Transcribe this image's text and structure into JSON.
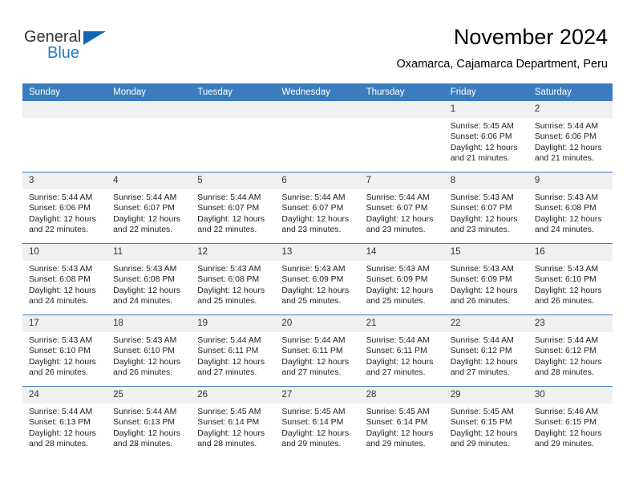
{
  "brand": {
    "name_part1": "General",
    "name_part2": "Blue"
  },
  "header": {
    "title": "November 2024",
    "subtitle": "Oxamarca, Cajamarca Department, Peru"
  },
  "calendar": {
    "weekday_headers": [
      "Sunday",
      "Monday",
      "Tuesday",
      "Wednesday",
      "Thursday",
      "Friday",
      "Saturday"
    ],
    "accent_color": "#3a7cbd",
    "daynum_band_color": "#f0f0f0",
    "weeks": [
      [
        {
          "day": "",
          "empty": true
        },
        {
          "day": "",
          "empty": true
        },
        {
          "day": "",
          "empty": true
        },
        {
          "day": "",
          "empty": true
        },
        {
          "day": "",
          "empty": true
        },
        {
          "day": "1",
          "sunrise": "Sunrise: 5:45 AM",
          "sunset": "Sunset: 6:06 PM",
          "daylight_l1": "Daylight: 12 hours",
          "daylight_l2": "and 21 minutes."
        },
        {
          "day": "2",
          "sunrise": "Sunrise: 5:44 AM",
          "sunset": "Sunset: 6:06 PM",
          "daylight_l1": "Daylight: 12 hours",
          "daylight_l2": "and 21 minutes."
        }
      ],
      [
        {
          "day": "3",
          "sunrise": "Sunrise: 5:44 AM",
          "sunset": "Sunset: 6:06 PM",
          "daylight_l1": "Daylight: 12 hours",
          "daylight_l2": "and 22 minutes."
        },
        {
          "day": "4",
          "sunrise": "Sunrise: 5:44 AM",
          "sunset": "Sunset: 6:07 PM",
          "daylight_l1": "Daylight: 12 hours",
          "daylight_l2": "and 22 minutes."
        },
        {
          "day": "5",
          "sunrise": "Sunrise: 5:44 AM",
          "sunset": "Sunset: 6:07 PM",
          "daylight_l1": "Daylight: 12 hours",
          "daylight_l2": "and 22 minutes."
        },
        {
          "day": "6",
          "sunrise": "Sunrise: 5:44 AM",
          "sunset": "Sunset: 6:07 PM",
          "daylight_l1": "Daylight: 12 hours",
          "daylight_l2": "and 23 minutes."
        },
        {
          "day": "7",
          "sunrise": "Sunrise: 5:44 AM",
          "sunset": "Sunset: 6:07 PM",
          "daylight_l1": "Daylight: 12 hours",
          "daylight_l2": "and 23 minutes."
        },
        {
          "day": "8",
          "sunrise": "Sunrise: 5:43 AM",
          "sunset": "Sunset: 6:07 PM",
          "daylight_l1": "Daylight: 12 hours",
          "daylight_l2": "and 23 minutes."
        },
        {
          "day": "9",
          "sunrise": "Sunrise: 5:43 AM",
          "sunset": "Sunset: 6:08 PM",
          "daylight_l1": "Daylight: 12 hours",
          "daylight_l2": "and 24 minutes."
        }
      ],
      [
        {
          "day": "10",
          "sunrise": "Sunrise: 5:43 AM",
          "sunset": "Sunset: 6:08 PM",
          "daylight_l1": "Daylight: 12 hours",
          "daylight_l2": "and 24 minutes."
        },
        {
          "day": "11",
          "sunrise": "Sunrise: 5:43 AM",
          "sunset": "Sunset: 6:08 PM",
          "daylight_l1": "Daylight: 12 hours",
          "daylight_l2": "and 24 minutes."
        },
        {
          "day": "12",
          "sunrise": "Sunrise: 5:43 AM",
          "sunset": "Sunset: 6:08 PM",
          "daylight_l1": "Daylight: 12 hours",
          "daylight_l2": "and 25 minutes."
        },
        {
          "day": "13",
          "sunrise": "Sunrise: 5:43 AM",
          "sunset": "Sunset: 6:09 PM",
          "daylight_l1": "Daylight: 12 hours",
          "daylight_l2": "and 25 minutes."
        },
        {
          "day": "14",
          "sunrise": "Sunrise: 5:43 AM",
          "sunset": "Sunset: 6:09 PM",
          "daylight_l1": "Daylight: 12 hours",
          "daylight_l2": "and 25 minutes."
        },
        {
          "day": "15",
          "sunrise": "Sunrise: 5:43 AM",
          "sunset": "Sunset: 6:09 PM",
          "daylight_l1": "Daylight: 12 hours",
          "daylight_l2": "and 26 minutes."
        },
        {
          "day": "16",
          "sunrise": "Sunrise: 5:43 AM",
          "sunset": "Sunset: 6:10 PM",
          "daylight_l1": "Daylight: 12 hours",
          "daylight_l2": "and 26 minutes."
        }
      ],
      [
        {
          "day": "17",
          "sunrise": "Sunrise: 5:43 AM",
          "sunset": "Sunset: 6:10 PM",
          "daylight_l1": "Daylight: 12 hours",
          "daylight_l2": "and 26 minutes."
        },
        {
          "day": "18",
          "sunrise": "Sunrise: 5:43 AM",
          "sunset": "Sunset: 6:10 PM",
          "daylight_l1": "Daylight: 12 hours",
          "daylight_l2": "and 26 minutes."
        },
        {
          "day": "19",
          "sunrise": "Sunrise: 5:44 AM",
          "sunset": "Sunset: 6:11 PM",
          "daylight_l1": "Daylight: 12 hours",
          "daylight_l2": "and 27 minutes."
        },
        {
          "day": "20",
          "sunrise": "Sunrise: 5:44 AM",
          "sunset": "Sunset: 6:11 PM",
          "daylight_l1": "Daylight: 12 hours",
          "daylight_l2": "and 27 minutes."
        },
        {
          "day": "21",
          "sunrise": "Sunrise: 5:44 AM",
          "sunset": "Sunset: 6:11 PM",
          "daylight_l1": "Daylight: 12 hours",
          "daylight_l2": "and 27 minutes."
        },
        {
          "day": "22",
          "sunrise": "Sunrise: 5:44 AM",
          "sunset": "Sunset: 6:12 PM",
          "daylight_l1": "Daylight: 12 hours",
          "daylight_l2": "and 27 minutes."
        },
        {
          "day": "23",
          "sunrise": "Sunrise: 5:44 AM",
          "sunset": "Sunset: 6:12 PM",
          "daylight_l1": "Daylight: 12 hours",
          "daylight_l2": "and 28 minutes."
        }
      ],
      [
        {
          "day": "24",
          "sunrise": "Sunrise: 5:44 AM",
          "sunset": "Sunset: 6:13 PM",
          "daylight_l1": "Daylight: 12 hours",
          "daylight_l2": "and 28 minutes."
        },
        {
          "day": "25",
          "sunrise": "Sunrise: 5:44 AM",
          "sunset": "Sunset: 6:13 PM",
          "daylight_l1": "Daylight: 12 hours",
          "daylight_l2": "and 28 minutes."
        },
        {
          "day": "26",
          "sunrise": "Sunrise: 5:45 AM",
          "sunset": "Sunset: 6:14 PM",
          "daylight_l1": "Daylight: 12 hours",
          "daylight_l2": "and 28 minutes."
        },
        {
          "day": "27",
          "sunrise": "Sunrise: 5:45 AM",
          "sunset": "Sunset: 6:14 PM",
          "daylight_l1": "Daylight: 12 hours",
          "daylight_l2": "and 29 minutes."
        },
        {
          "day": "28",
          "sunrise": "Sunrise: 5:45 AM",
          "sunset": "Sunset: 6:14 PM",
          "daylight_l1": "Daylight: 12 hours",
          "daylight_l2": "and 29 minutes."
        },
        {
          "day": "29",
          "sunrise": "Sunrise: 5:45 AM",
          "sunset": "Sunset: 6:15 PM",
          "daylight_l1": "Daylight: 12 hours",
          "daylight_l2": "and 29 minutes."
        },
        {
          "day": "30",
          "sunrise": "Sunrise: 5:46 AM",
          "sunset": "Sunset: 6:15 PM",
          "daylight_l1": "Daylight: 12 hours",
          "daylight_l2": "and 29 minutes."
        }
      ]
    ]
  }
}
